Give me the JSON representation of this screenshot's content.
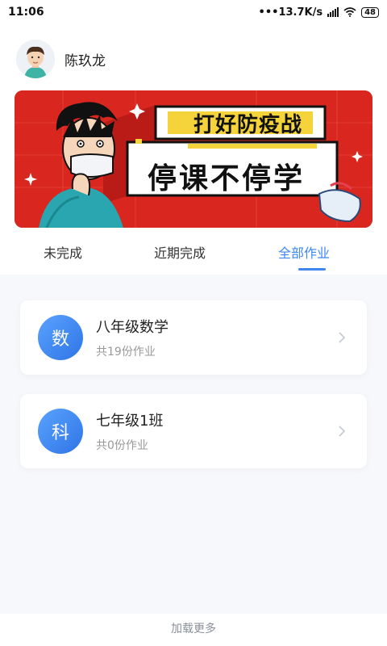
{
  "status_bar": {
    "time": "11:06",
    "network_speed": "•••13.7K/s",
    "battery": "48"
  },
  "user": {
    "name": "陈玖龙",
    "avatar_icon": "user-avatar-icon"
  },
  "banner": {
    "title_small": "打好防疫战",
    "title_big": "停课不停学",
    "colors": {
      "background": "#d9261f",
      "highlight": "#f5d33a"
    }
  },
  "tabs": [
    {
      "label": "未完成",
      "active": false
    },
    {
      "label": "近期完成",
      "active": false
    },
    {
      "label": "全部作业",
      "active": true
    }
  ],
  "classes": [
    {
      "icon_text": "数",
      "title": "八年级数学",
      "subtitle": "共19份作业"
    },
    {
      "icon_text": "科",
      "title": "七年级1班",
      "subtitle": "共0份作业"
    }
  ],
  "footer": {
    "load_more": "加载更多"
  },
  "colors": {
    "accent": "#3d86f0",
    "page_bg": "#f7f8fb"
  }
}
